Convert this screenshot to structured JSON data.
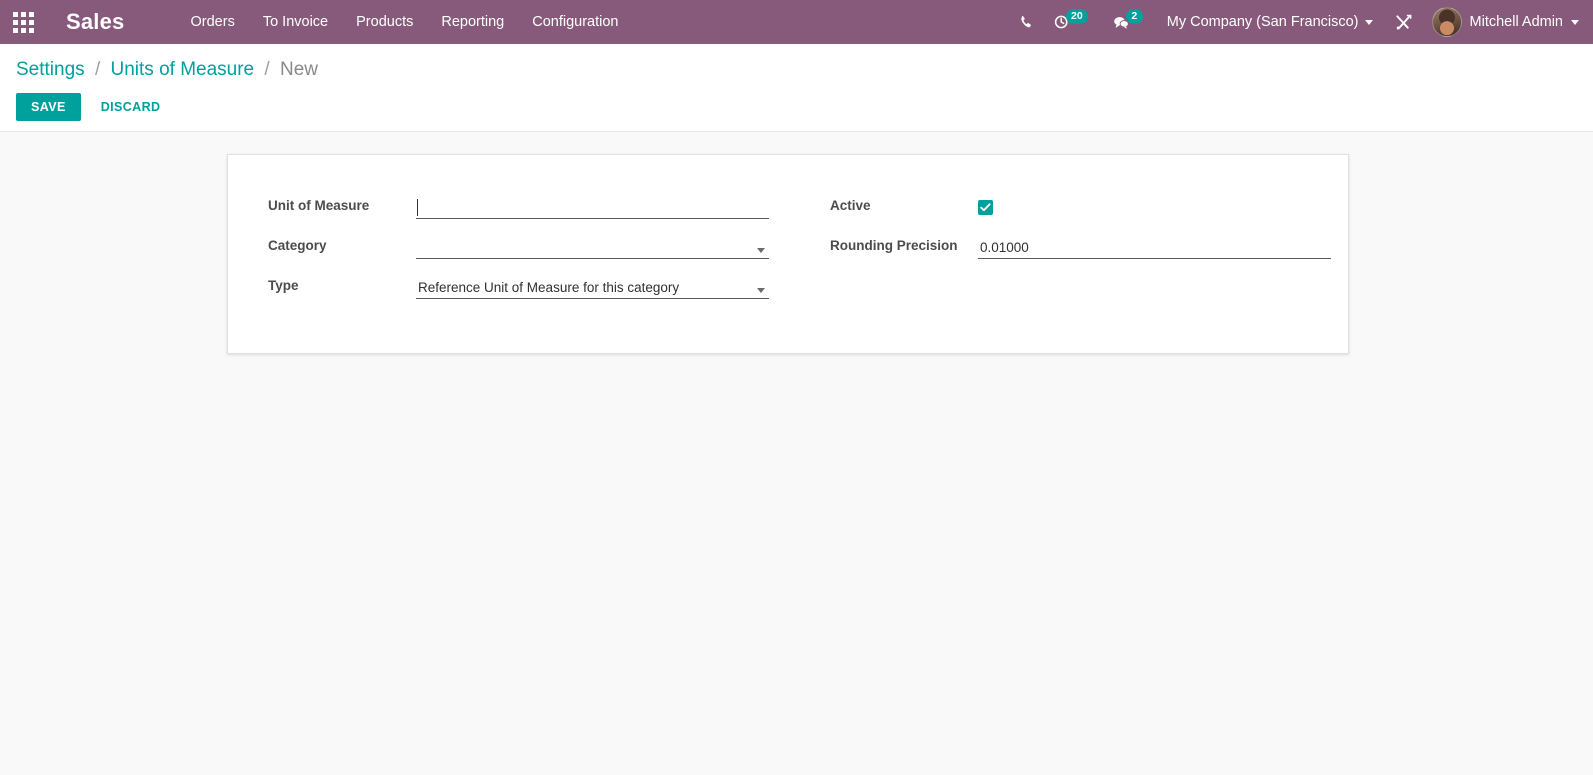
{
  "navbar": {
    "apps_icon": "apps-grid-icon",
    "brand": "Sales",
    "menu": [
      {
        "label": "Orders"
      },
      {
        "label": "To Invoice"
      },
      {
        "label": "Products"
      },
      {
        "label": "Reporting"
      },
      {
        "label": "Configuration"
      }
    ],
    "phone_icon": "phone-icon",
    "activity_icon": "clock-activity-icon",
    "activity_count": "20",
    "messages_icon": "comments-icon",
    "messages_count": "2",
    "company": "My Company (San Francisco)",
    "debug_icon": "debug-tools-icon",
    "user_name": "Mitchell Admin",
    "avatar_icon": "user-avatar",
    "background_color": "#875A7B"
  },
  "control_panel": {
    "breadcrumb": {
      "root": "Settings",
      "parent": "Units of Measure",
      "current": "New",
      "separator": "/"
    },
    "save_label": "SAVE",
    "discard_label": "DISCARD",
    "accent_color": "#00A09D"
  },
  "form": {
    "left": {
      "unit_of_measure": {
        "label": "Unit of Measure",
        "value": "",
        "placeholder": ""
      },
      "category": {
        "label": "Category",
        "value": "",
        "placeholder": ""
      },
      "type": {
        "label": "Type",
        "value": "Reference Unit of Measure for this category",
        "placeholder": ""
      }
    },
    "right": {
      "active": {
        "label": "Active",
        "checked": "true"
      },
      "rounding_precision": {
        "label": "Rounding Precision",
        "value": "0.01000",
        "placeholder": ""
      }
    }
  }
}
